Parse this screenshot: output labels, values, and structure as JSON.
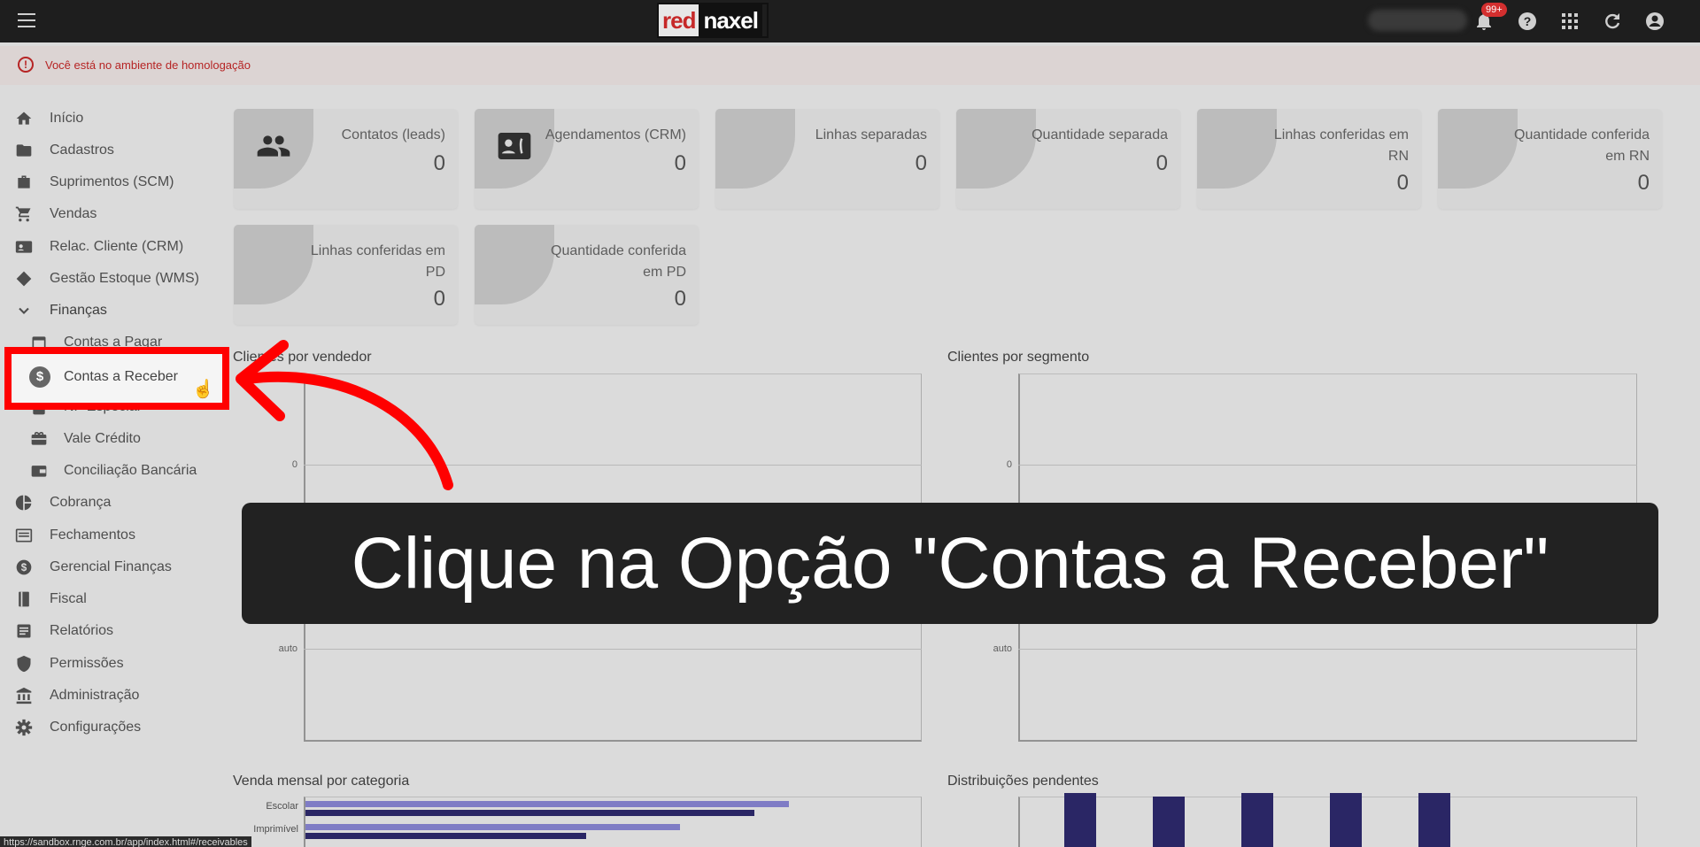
{
  "topbar": {
    "logo_red": "red",
    "logo_naxel": "naxel",
    "notifications_badge": "99+"
  },
  "banner": {
    "text": "Você está no ambiente de homologação"
  },
  "sidebar": {
    "items": [
      {
        "label": "Início",
        "icon": "home-icon"
      },
      {
        "label": "Cadastros",
        "icon": "folder-icon"
      },
      {
        "label": "Suprimentos (SCM)",
        "icon": "briefcase-icon"
      },
      {
        "label": "Vendas",
        "icon": "cart-icon"
      },
      {
        "label": "Relac. Cliente (CRM)",
        "icon": "contact-card-icon"
      },
      {
        "label": "Gestão Estoque (WMS)",
        "icon": "diamond-icon"
      },
      {
        "label": "Finanças",
        "icon": "chevron-down-icon"
      },
      {
        "label": "Contas a Pagar",
        "icon": "calendar-icon"
      },
      {
        "label": "Contas a Receber",
        "icon": "dollar-icon"
      },
      {
        "label": "NF Especial",
        "icon": "document-icon"
      },
      {
        "label": "Vale Crédito",
        "icon": "gift-card-icon"
      },
      {
        "label": "Conciliação Bancária",
        "icon": "wallet-icon"
      },
      {
        "label": "Cobrança",
        "icon": "pie-chart-icon"
      },
      {
        "label": "Fechamentos",
        "icon": "list-icon"
      },
      {
        "label": "Gerencial Finanças",
        "icon": "dollar-icon"
      },
      {
        "label": "Fiscal",
        "icon": "book-icon"
      },
      {
        "label": "Relatórios",
        "icon": "report-icon"
      },
      {
        "label": "Permissões",
        "icon": "shield-icon"
      },
      {
        "label": "Administração",
        "icon": "bank-icon"
      },
      {
        "label": "Configurações",
        "icon": "gear-icon"
      }
    ]
  },
  "cards": [
    {
      "title": "Contatos (leads)",
      "value": "0"
    },
    {
      "title": "Agendamentos (CRM)",
      "value": "0"
    },
    {
      "title": "Linhas separadas",
      "value": "0"
    },
    {
      "title": "Quantidade separada",
      "value": "0"
    },
    {
      "title": "Linhas conferidas em RN",
      "value": "0"
    },
    {
      "title": "Quantidade conferida em RN",
      "value": "0"
    },
    {
      "title": "Linhas conferidas em PD",
      "value": "0"
    },
    {
      "title": "Quantidade conferida em PD",
      "value": "0"
    }
  ],
  "panels": {
    "vendedor_title": "Clientes por vendedor",
    "segmento_title": "Clientes por segmento",
    "tick_0": "0",
    "tick_auto": "auto",
    "venda_title": "Venda mensal por categoria",
    "dist_title": "Distribuições pendentes"
  },
  "chart_data": [
    {
      "type": "bar",
      "title": "Venda mensal por categoria",
      "categories": [
        "Escolar",
        "Imprimível"
      ],
      "series": [
        {
          "color": "#8a87d6",
          "values": [
            0.98,
            0.76
          ]
        },
        {
          "color": "#2e2a6e",
          "values": [
            0.91,
            0.57
          ]
        }
      ]
    },
    {
      "type": "bar",
      "title": "Distribuições pendentes",
      "values": [
        1,
        0.94,
        1,
        1,
        1
      ]
    }
  ],
  "caption": "Clique na Opção \"Contas a Receber\"",
  "statusbar": "https://sandbox.rnge.com.br/app/index.html#/receivables"
}
